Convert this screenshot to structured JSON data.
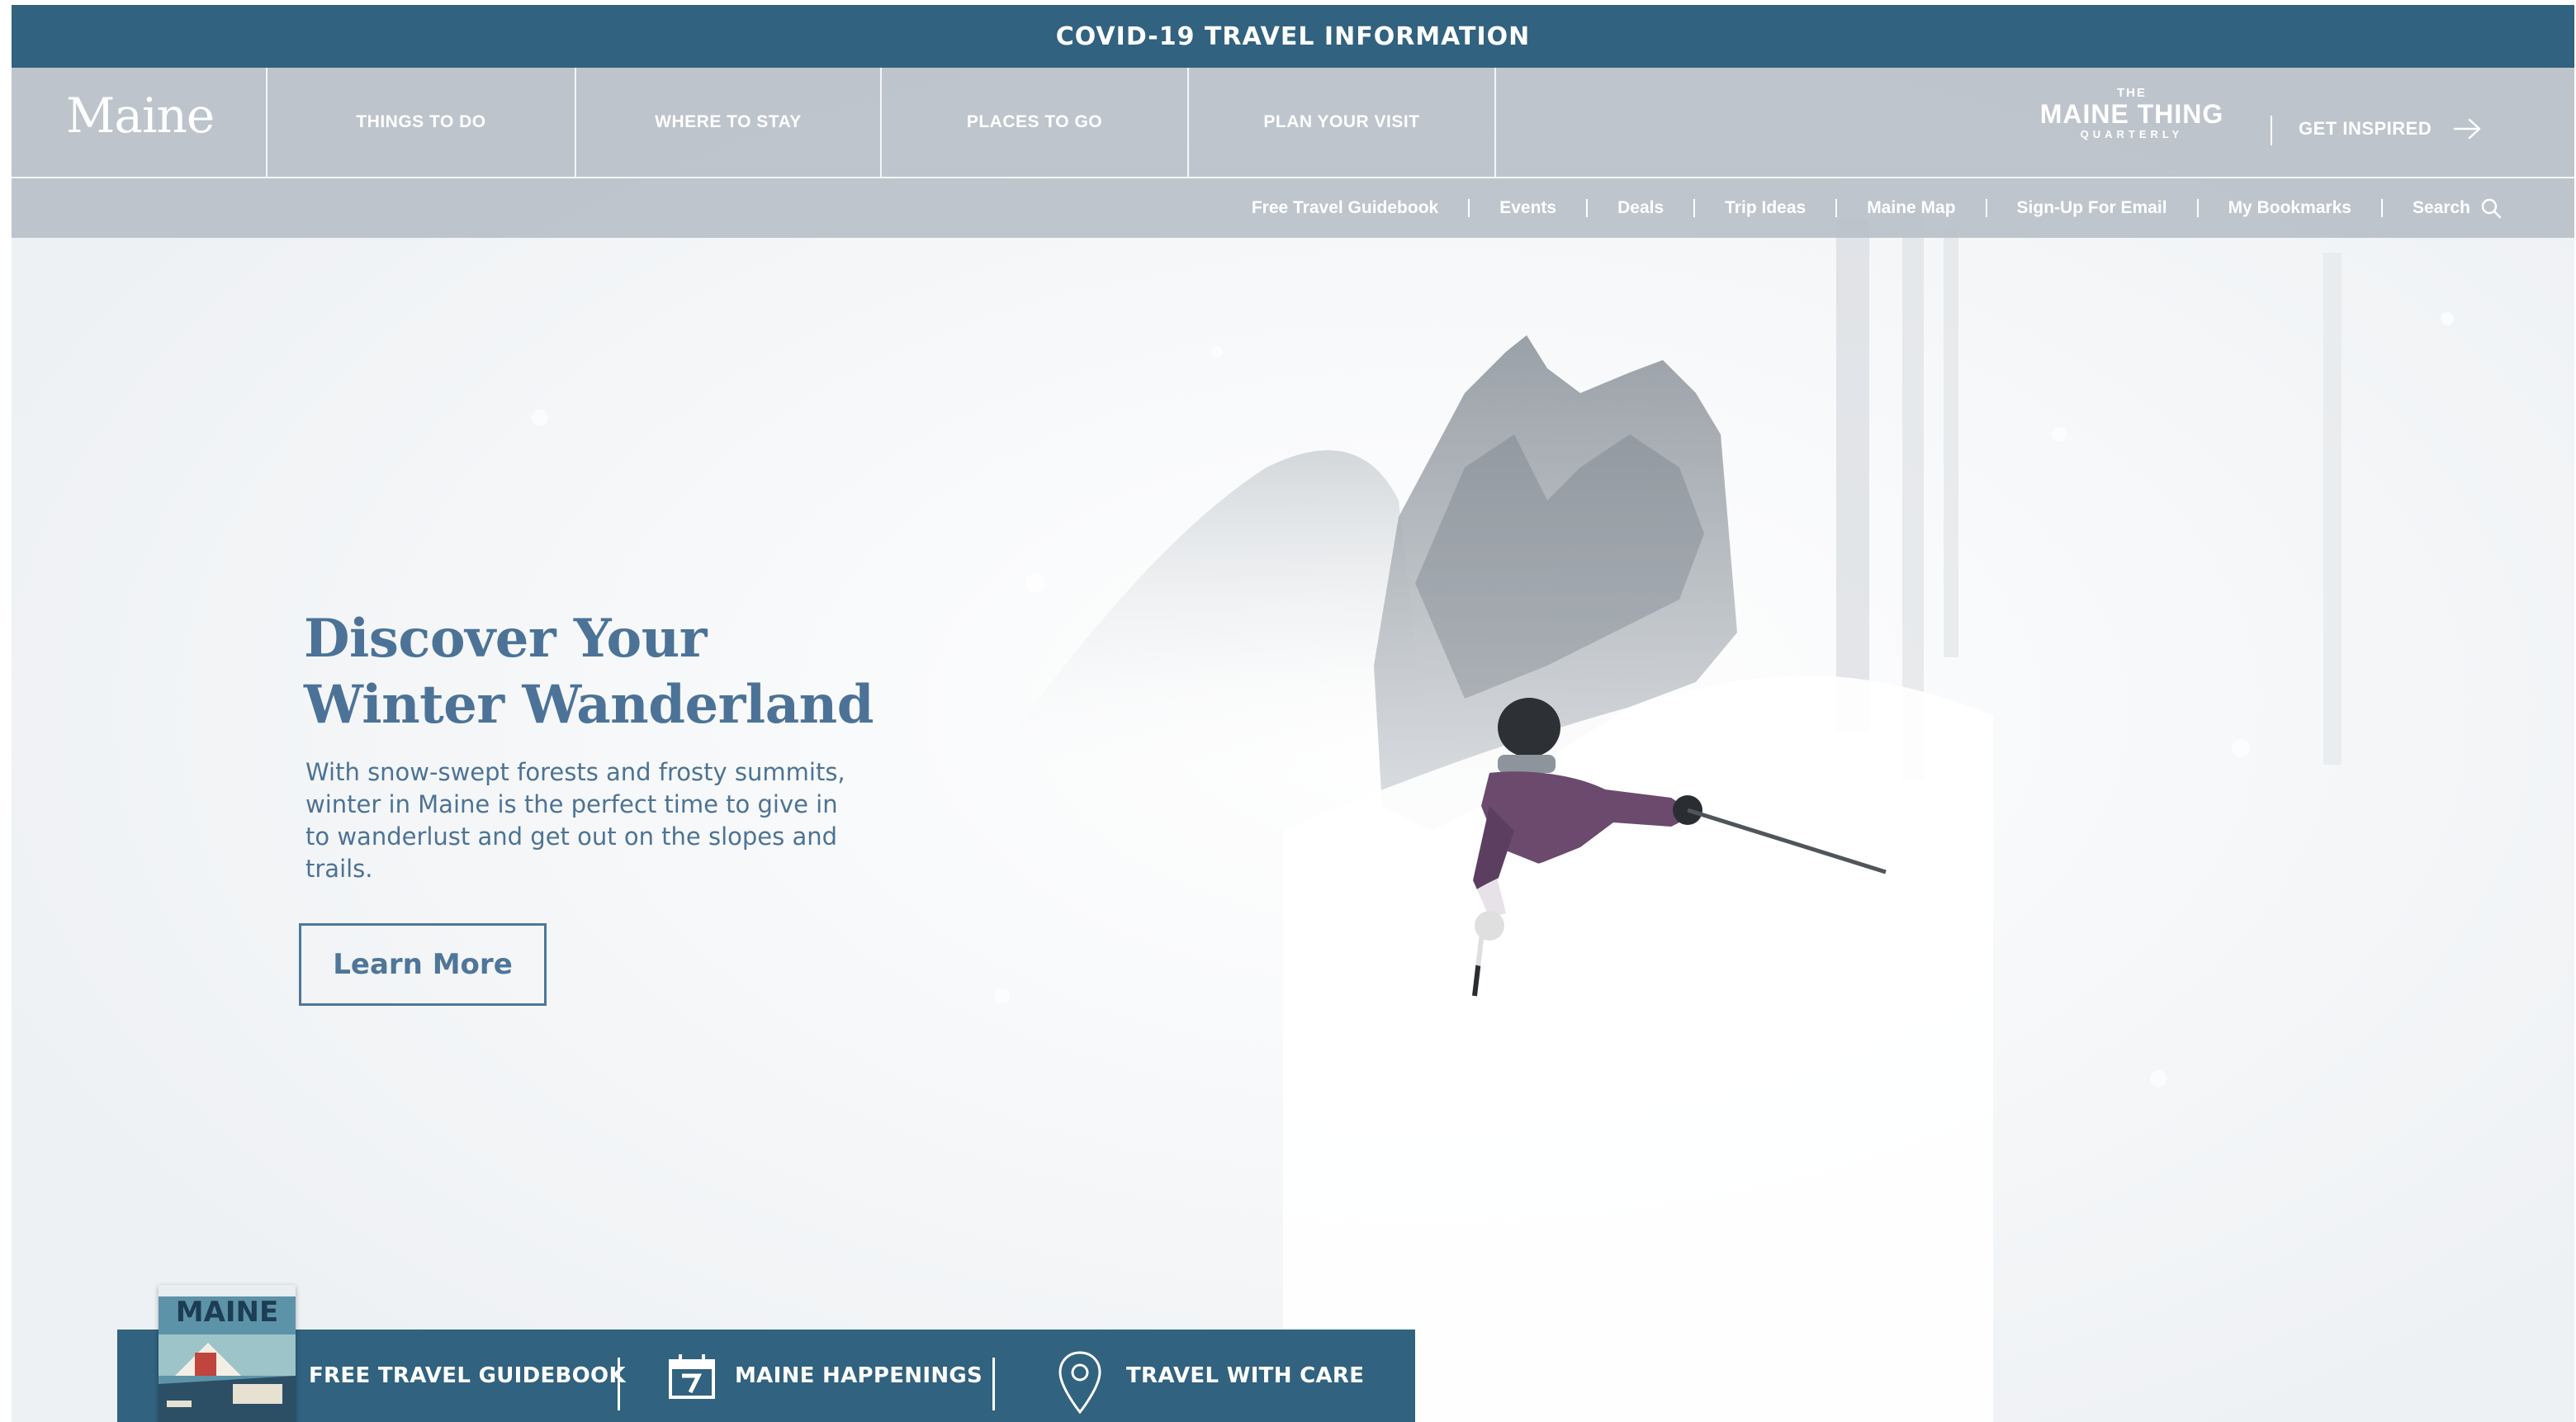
{
  "covid_bar": {
    "label": "COVID-19 TRAVEL INFORMATION"
  },
  "header": {
    "logo": "Maine",
    "nav": [
      {
        "label": "THINGS TO DO"
      },
      {
        "label": "WHERE TO STAY"
      },
      {
        "label": "PLACES TO GO"
      },
      {
        "label": "PLAN YOUR VISIT"
      }
    ],
    "quarterly": {
      "the": "THE",
      "title": "MAINE THING",
      "sub": "QUARTERLY"
    },
    "get_inspired": "GET INSPIRED",
    "subnav": [
      {
        "label": "Free Travel Guidebook"
      },
      {
        "label": "Events"
      },
      {
        "label": "Deals"
      },
      {
        "label": "Trip Ideas"
      },
      {
        "label": "Maine Map"
      },
      {
        "label": "Sign-Up For Email"
      },
      {
        "label": "My Bookmarks"
      }
    ],
    "search_label": "Search"
  },
  "hero": {
    "headline_line1": "Discover Your",
    "headline_line2": "Winter Wanderland",
    "description": "With snow-swept forests and frosty summits, winter in Maine is the perfect time to give in to wanderlust and get out on the slopes and trails.",
    "cta": "Learn More"
  },
  "bottom_bar": {
    "guidebook_cover_title": "MAINE",
    "items": [
      {
        "label": "FREE TRAVEL GUIDEBOOK",
        "icon": "guidebook-cover"
      },
      {
        "label": "MAINE HAPPENINGS",
        "icon": "calendar-icon"
      },
      {
        "label": "TRAVEL WITH CARE",
        "icon": "location-pin-icon"
      }
    ]
  },
  "colors": {
    "brand_blue": "#31627f",
    "header_gray": "#bac0c8",
    "headline_blue": "#4c7397"
  }
}
